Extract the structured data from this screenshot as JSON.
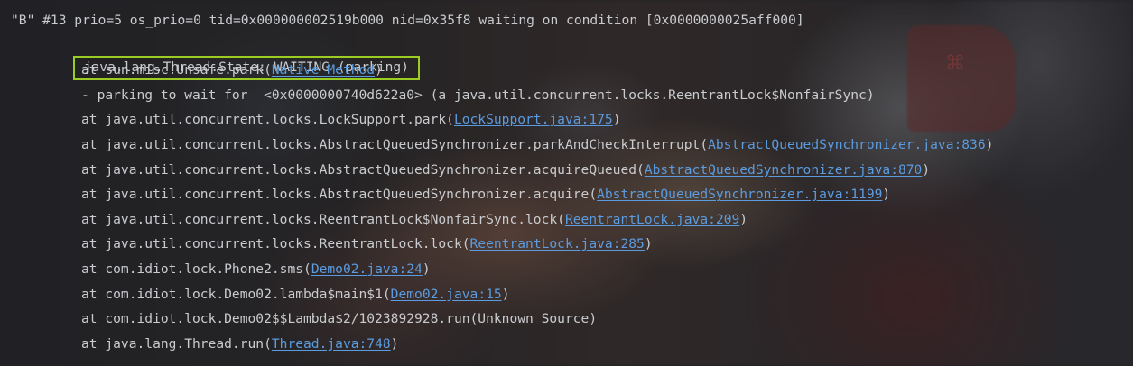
{
  "thread_header": "\"B\" #13 prio=5 os_prio=0 tid=0x000000002519b000 nid=0x35f8 waiting on condition [0x0000000025aff000]",
  "thread_state": "java.lang.Thread.State: WAITING (parking)",
  "highlight_color": "#9acd1f",
  "link_color": "#5b9bdf",
  "frames": [
    {
      "prefix": "at sun.misc.Unsafe.park(",
      "link": "Native Method",
      "suffix": ")"
    },
    {
      "prefix": "- parking to wait for  <0x0000000740d622a0> (a java.util.concurrent.locks.ReentrantLock$NonfairSync)",
      "link": "",
      "suffix": ""
    },
    {
      "prefix": "at java.util.concurrent.locks.LockSupport.park(",
      "link": "LockSupport.java:175",
      "suffix": ")"
    },
    {
      "prefix": "at java.util.concurrent.locks.AbstractQueuedSynchronizer.parkAndCheckInterrupt(",
      "link": "AbstractQueuedSynchronizer.java:836",
      "suffix": ")"
    },
    {
      "prefix": "at java.util.concurrent.locks.AbstractQueuedSynchronizer.acquireQueued(",
      "link": "AbstractQueuedSynchronizer.java:870",
      "suffix": ")"
    },
    {
      "prefix": "at java.util.concurrent.locks.AbstractQueuedSynchronizer.acquire(",
      "link": "AbstractQueuedSynchronizer.java:1199",
      "suffix": ")"
    },
    {
      "prefix": "at java.util.concurrent.locks.ReentrantLock$NonfairSync.lock(",
      "link": "ReentrantLock.java:209",
      "suffix": ")"
    },
    {
      "prefix": "at java.util.concurrent.locks.ReentrantLock.lock(",
      "link": "ReentrantLock.java:285",
      "suffix": ")"
    },
    {
      "prefix": "at com.idiot.lock.Phone2.sms(",
      "link": "Demo02.java:24",
      "suffix": ")"
    },
    {
      "prefix": "at com.idiot.lock.Demo02.lambda$main$1(",
      "link": "Demo02.java:15",
      "suffix": ")"
    },
    {
      "prefix": "at com.idiot.lock.Demo02$$Lambda$2/1023892928.run(Unknown Source)",
      "link": "",
      "suffix": ""
    },
    {
      "prefix": "at java.lang.Thread.run(",
      "link": "Thread.java:748",
      "suffix": ")"
    }
  ]
}
